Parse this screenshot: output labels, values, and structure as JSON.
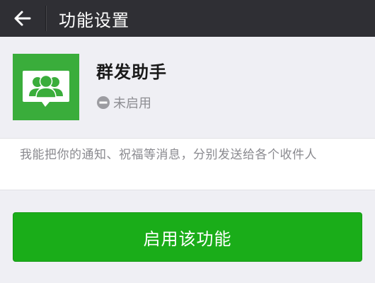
{
  "header": {
    "back_icon": "arrow-left-icon",
    "title": "功能设置"
  },
  "feature": {
    "icon": "group-users-icon",
    "icon_bg": "#3aad3b",
    "name": "群发助手",
    "status_icon": "minus-circle-icon",
    "status": "未启用"
  },
  "description": {
    "text": "我能把你的通知、祝福等消息，分别发送给各个收件人"
  },
  "actions": {
    "enable_label": "启用该功能",
    "enable_color": "#1aad19"
  }
}
